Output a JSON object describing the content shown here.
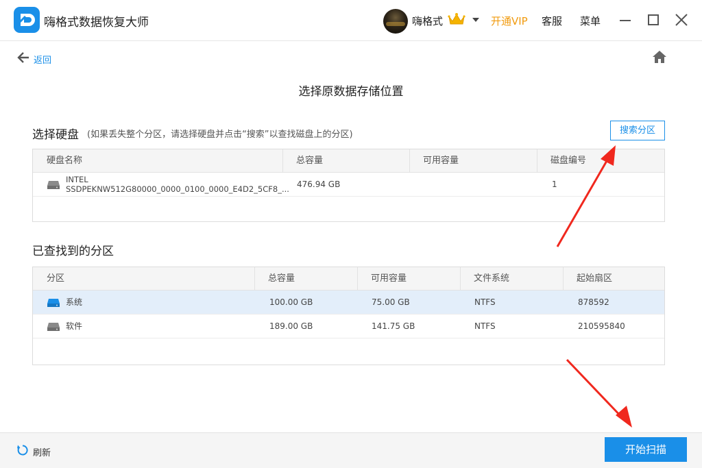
{
  "titlebar": {
    "app_title": "嗨格式数据恢复大师",
    "username": "嗨格式",
    "vip_label": "开通VIP",
    "service_label": "客服",
    "menu_label": "菜单"
  },
  "nav": {
    "back_label": "返回"
  },
  "page_title": "选择原数据存储位置",
  "disks": {
    "title": "选择硬盘",
    "hint": "(如果丢失整个分区，请选择硬盘并点击“搜索”以查找磁盘上的分区)",
    "search_button": "搜索分区",
    "columns": [
      "硬盘名称",
      "总容量",
      "可用容量",
      "磁盘编号"
    ],
    "rows": [
      {
        "name_line1": "INTEL",
        "name_line2": "SSDPEKNW512G80000_0000_0100_0000_E4D2_5CF8_...",
        "total": "476.94 GB",
        "free": "",
        "number": "1"
      }
    ]
  },
  "partitions": {
    "title": "已查找到的分区",
    "columns": [
      "分区",
      "总容量",
      "可用容量",
      "文件系统",
      "起始扇区"
    ],
    "rows": [
      {
        "name": "系统",
        "total": "100.00 GB",
        "free": "75.00 GB",
        "fs": "NTFS",
        "start": "878592",
        "selected": true
      },
      {
        "name": "软件",
        "total": "189.00 GB",
        "free": "141.75 GB",
        "fs": "NTFS",
        "start": "210595840",
        "selected": false
      }
    ]
  },
  "footer": {
    "refresh_label": "刷新",
    "start_button": "开始扫描"
  },
  "colors": {
    "accent": "#1a8fe8",
    "vip": "#f19b0f",
    "selected_row": "#e3eefa",
    "annotation_arrow": "#f0281e"
  },
  "icons": [
    "app-logo-icon",
    "crown-icon",
    "chevron-down-icon",
    "minimize-icon",
    "maximize-icon",
    "close-icon",
    "back-arrow-icon",
    "home-icon",
    "disk-drive-icon",
    "refresh-icon"
  ]
}
